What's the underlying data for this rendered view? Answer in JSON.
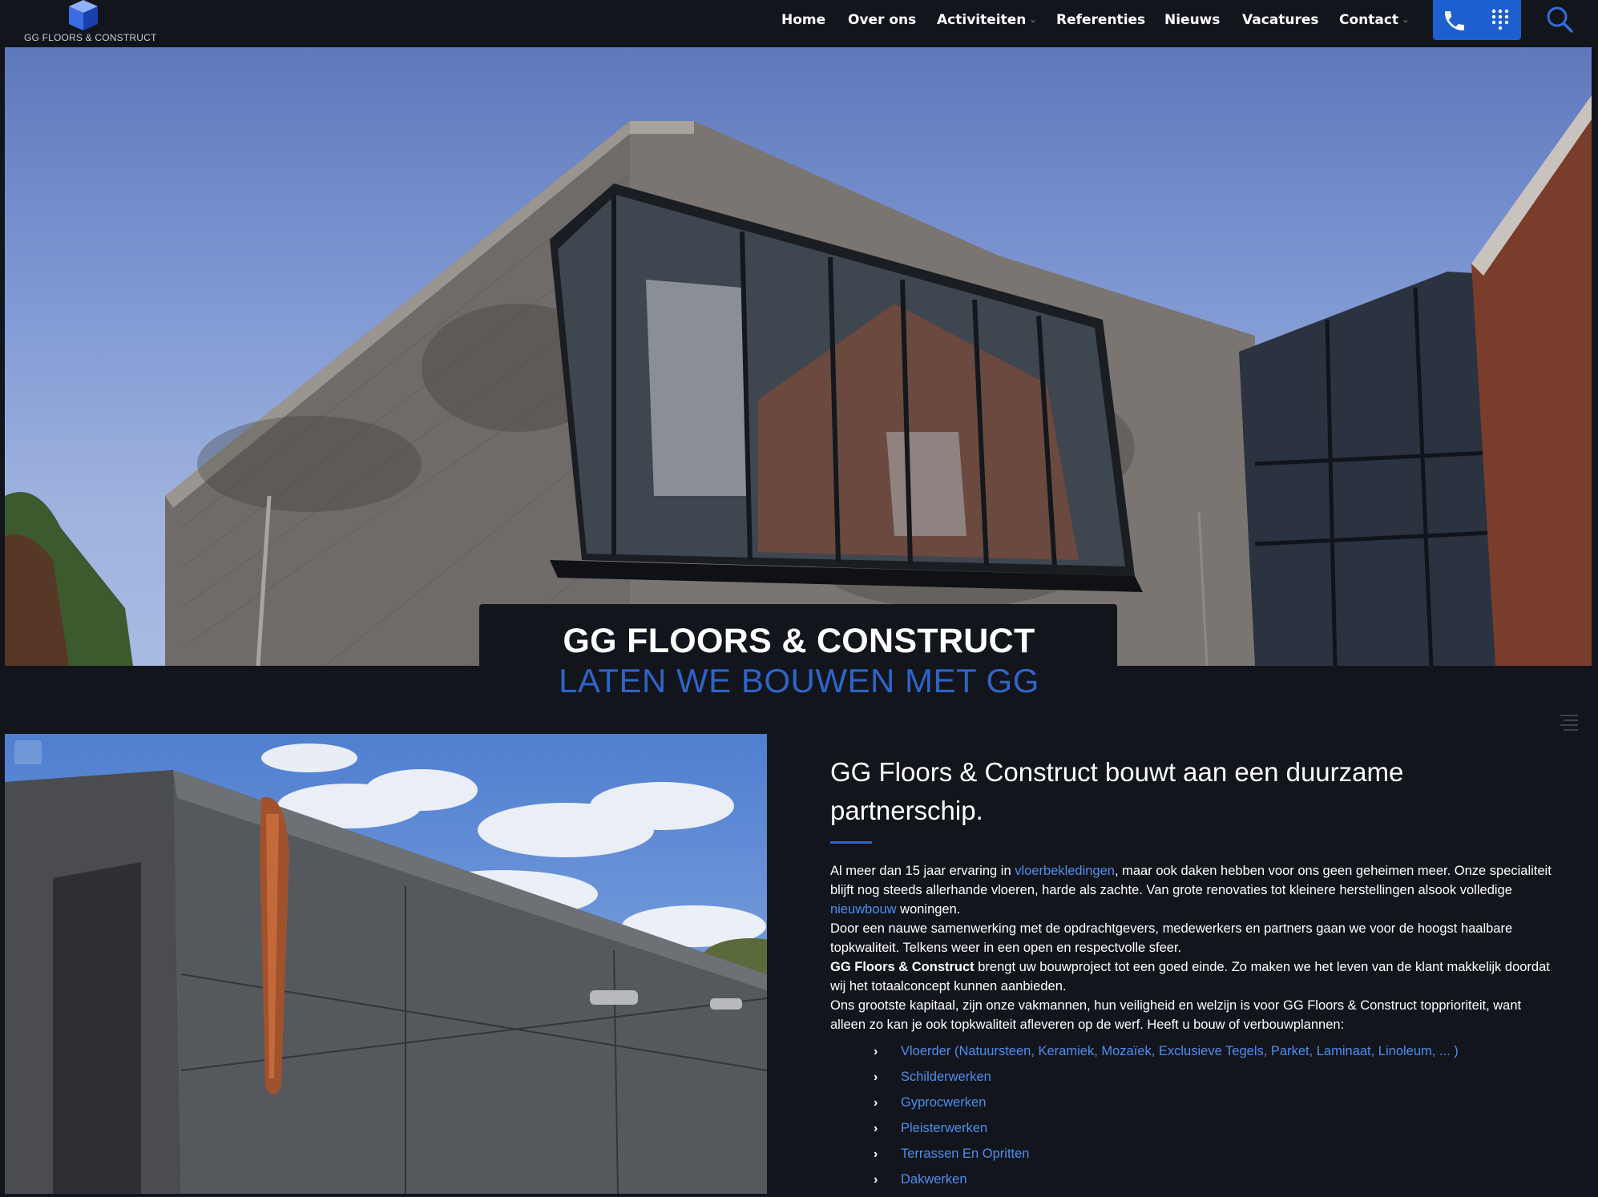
{
  "header": {
    "logo_text": "GG FLOORS & CONSTRUCT",
    "nav": [
      {
        "label": "Home"
      },
      {
        "label": "Over ons"
      },
      {
        "label": "Activiteiten",
        "has_dropdown": true
      },
      {
        "label": "Referenties"
      },
      {
        "label": "Nieuws"
      },
      {
        "label": "Vacatures"
      },
      {
        "label": "Contact",
        "has_dropdown": true
      }
    ],
    "cta_icons": [
      "phone-icon",
      "dialpad-icon"
    ],
    "search_icon": "search-icon"
  },
  "hero": {
    "title": "GG FLOORS & CONSTRUCT",
    "subtitle": "LATEN WE BOUWEN MET GG"
  },
  "content": {
    "heading": "GG Floors & Construct bouwt aan een duurzame partnerschip.",
    "p1_before": "Al meer dan 15 jaar ervaring in ",
    "p1_link1": "vloerbekledingen",
    "p1_mid": ", maar ook daken hebben voor ons geen geheimen meer. Onze specialiteit blijft nog steeds allerhande vloeren, harde als zachte. Van grote renovaties tot kleinere herstellingen alsook volledige ",
    "p1_link2": "nieuwbouw",
    "p1_after": " woningen.",
    "p2": "Door een nauwe samenwerking met de opdrachtgevers, medewerkers en partners gaan we voor de hoogst haalbare topkwaliteit. Telkens weer in een open en respectvolle sfeer.",
    "p3_bold": "GG Floors & Construct",
    "p3_rest": " brengt uw bouwproject tot een goed einde. Zo maken we het leven van de klant makkelijk doordat wij het totaalconcept kunnen aanbieden.",
    "p4": "Ons grootste kapitaal, zijn onze vakmannen, hun veiligheid en welzijn is voor GG Floors & Construct topprioriteit, want alleen zo kan je ook topkwaliteit afleveren op de werf. Heeft u bouw of verbouwplannen:",
    "services": [
      "Vloerder (Natuursteen, Keramiek, Mozaïek, Exclusieve Tegels, Parket, Laminaat, Linoleum, ... )",
      "Schilderwerken",
      "Gyprocwerken",
      "Pleisterwerken",
      "Terrassen En Opritten",
      "Dakwerken"
    ]
  },
  "colors": {
    "background": "#13151c",
    "accent": "#2f64c7",
    "link": "#4d8ff0",
    "cta": "#1e5fcf"
  }
}
